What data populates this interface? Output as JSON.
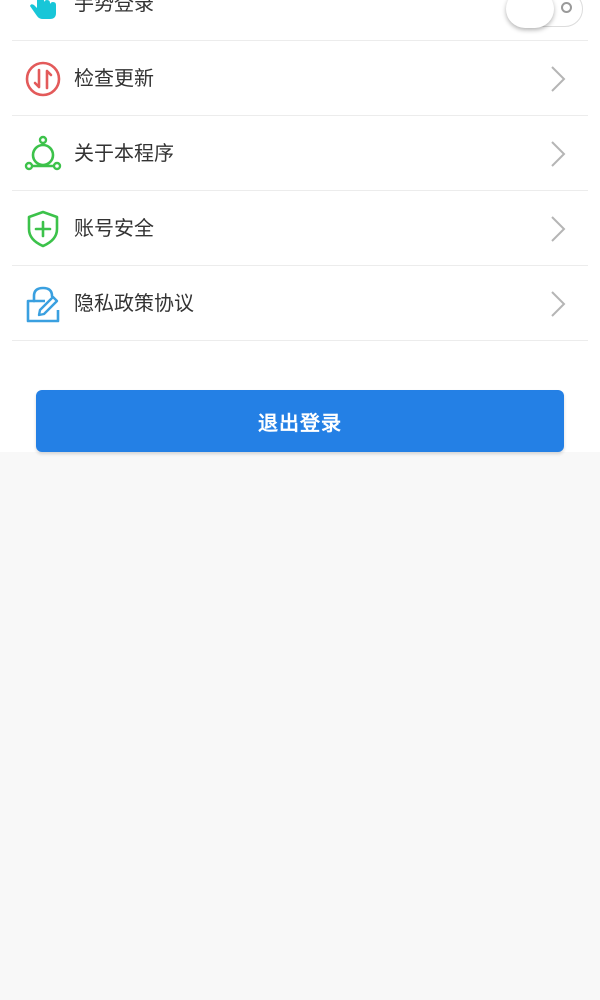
{
  "settings": {
    "items": [
      {
        "label": "手势登录",
        "icon": "hand-gesture-icon",
        "control": "toggle",
        "toggle_on": false
      },
      {
        "label": "检查更新",
        "icon": "update-arrows-icon",
        "control": "chevron"
      },
      {
        "label": "关于本程序",
        "icon": "nodes-about-icon",
        "control": "chevron"
      },
      {
        "label": "账号安全",
        "icon": "shield-plus-icon",
        "control": "chevron"
      },
      {
        "label": "隐私政策协议",
        "icon": "lock-edit-icon",
        "control": "chevron"
      }
    ]
  },
  "logout": {
    "label": "退出登录"
  },
  "colors": {
    "accent_blue": "#2480e5",
    "update_red": "#e35a5a",
    "about_green": "#3cc24a",
    "security_green": "#3cc24a",
    "privacy_blue": "#3aa0e0",
    "gesture_cyan": "#18c6d8",
    "page_background": "#f8f8f8"
  }
}
